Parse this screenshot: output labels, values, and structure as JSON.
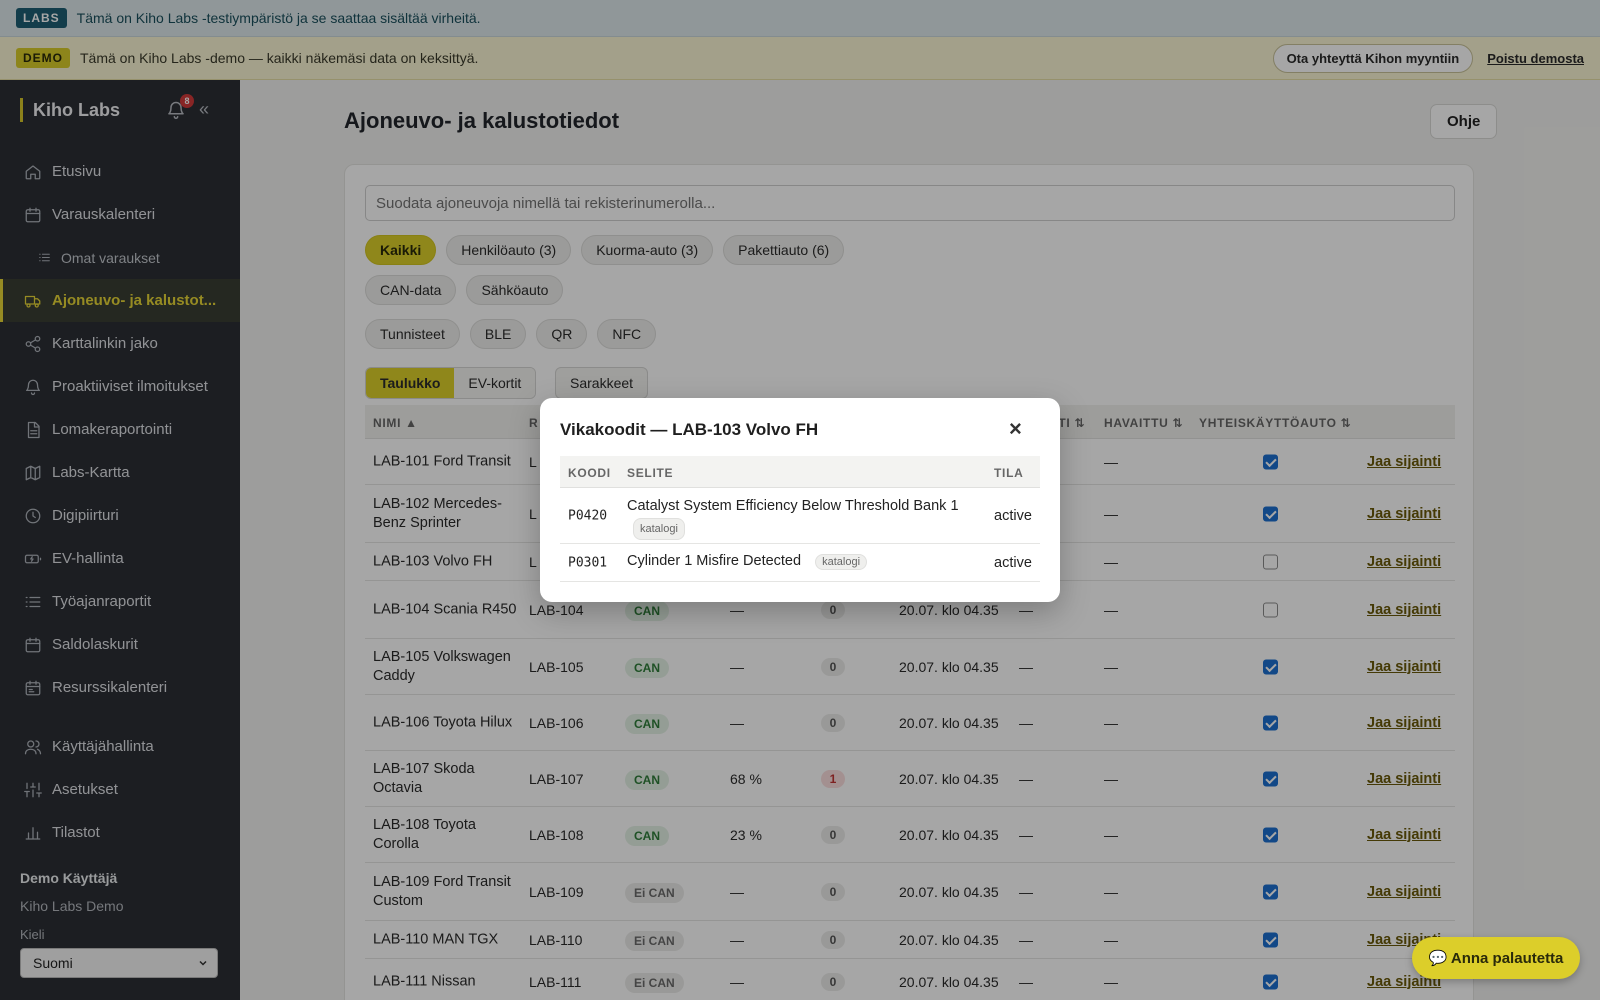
{
  "banners": {
    "labs_tag": "LABS",
    "labs_text": "Tämä on Kiho Labs -testiympäristö ja se saattaa sisältää virheitä.",
    "demo_tag": "DEMO",
    "demo_text": "Tämä on Kiho Labs -demo — kaikki näkemäsi data on keksittyä.",
    "contact_label": "Ota yhteyttä Kihon myyntiin",
    "exit_label": "Poistu demosta"
  },
  "sidebar": {
    "brand": "Kiho Labs",
    "notification_count": "8",
    "collapse_icon": "«",
    "items": [
      {
        "label": "Etusivu",
        "icon": "home-icon"
      },
      {
        "label": "Varauskalenteri",
        "icon": "calendar-icon"
      },
      {
        "label": "Omat varaukset",
        "icon": "list-icon"
      },
      {
        "label": "Ajoneuvo- ja kalustot...",
        "icon": "truck-icon"
      },
      {
        "label": "Karttalinkin jako",
        "icon": "share-icon"
      },
      {
        "label": "Proaktiiviset ilmoitukset",
        "icon": "bell-icon"
      },
      {
        "label": "Lomakeraportointi",
        "icon": "document-icon"
      },
      {
        "label": "Labs-Kartta",
        "icon": "map-icon"
      },
      {
        "label": "Digipiirturi",
        "icon": "clock-icon"
      },
      {
        "label": "EV-hallinta",
        "icon": "battery-icon"
      },
      {
        "label": "Työajanraportit",
        "icon": "list-icon"
      },
      {
        "label": "Saldolaskurit",
        "icon": "calendar-icon"
      },
      {
        "label": "Resurssikalenteri",
        "icon": "calendar-icon"
      },
      {
        "label": "Käyttäjähallinta",
        "icon": "users-icon"
      },
      {
        "label": "Asetukset",
        "icon": "sliders-icon"
      },
      {
        "label": "Tilastot",
        "icon": "bar-chart-icon"
      }
    ],
    "user_name": "Demo Käyttäjä",
    "org_name": "Kiho Labs Demo",
    "language_label": "Kieli",
    "language_value": "Suomi"
  },
  "main": {
    "title": "Ajoneuvo- ja kalustotiedot",
    "help_label": "Ohje",
    "filter_placeholder": "Suodata ajoneuvoja nimellä tai rekisterinumerolla...",
    "type_filters": [
      "Kaikki",
      "Henkilöauto (3)",
      "Kuorma-auto (3)",
      "Pakettiauto (6)"
    ],
    "feature_filters": [
      "CAN-data",
      "Sähköauto"
    ],
    "tag_filters": [
      "Tunnisteet",
      "BLE",
      "QR",
      "NFC"
    ],
    "views": [
      "Taulukko",
      "EV-kortit"
    ],
    "columns_label": "Sarakkeet",
    "table": {
      "headers": {
        "name": "NIMI ▲",
        "plate": "R",
        "location": "INTI ⇅",
        "seen": "HAVAITTU ⇅",
        "shared": "YHTEISKÄYTTÖAUTO ⇅"
      },
      "share_label": "Jaa sijainti",
      "rows": [
        {
          "name": "LAB-101 Ford Transit",
          "plate": "L",
          "can": "",
          "battery": "",
          "codes": "",
          "updated": "",
          "location": "—",
          "seen": "—",
          "shared": true
        },
        {
          "name": "LAB-102 Mercedes-Benz Sprinter",
          "plate": "L",
          "can": "",
          "battery": "",
          "codes": "",
          "updated": "",
          "location": "—",
          "seen": "—",
          "shared": true
        },
        {
          "name": "LAB-103 Volvo FH",
          "plate": "L",
          "can": "",
          "battery": "",
          "codes": "",
          "updated": "",
          "location": "—",
          "seen": "—",
          "shared": false
        },
        {
          "name": "LAB-104 Scania R450",
          "plate": "LAB-104",
          "can": "CAN",
          "battery": "—",
          "codes": "0",
          "updated": "20.07. klo 04.35",
          "location": "—",
          "seen": "—",
          "shared": false
        },
        {
          "name": "LAB-105 Volkswagen Caddy",
          "plate": "LAB-105",
          "can": "CAN",
          "battery": "—",
          "codes": "0",
          "updated": "20.07. klo 04.35",
          "location": "—",
          "seen": "—",
          "shared": true
        },
        {
          "name": "LAB-106 Toyota Hilux",
          "plate": "LAB-106",
          "can": "CAN",
          "battery": "—",
          "codes": "0",
          "updated": "20.07. klo 04.35",
          "location": "—",
          "seen": "—",
          "shared": true
        },
        {
          "name": "LAB-107 Skoda Octavia",
          "plate": "LAB-107",
          "can": "CAN",
          "battery": "68 %",
          "codes": "1",
          "updated": "20.07. klo 04.35",
          "location": "—",
          "seen": "—",
          "shared": true
        },
        {
          "name": "LAB-108 Toyota Corolla",
          "plate": "LAB-108",
          "can": "CAN",
          "battery": "23 %",
          "codes": "0",
          "updated": "20.07. klo 04.35",
          "location": "—",
          "seen": "—",
          "shared": true
        },
        {
          "name": "LAB-109 Ford Transit Custom",
          "plate": "LAB-109",
          "can": "Ei CAN",
          "battery": "—",
          "codes": "0",
          "updated": "20.07. klo 04.35",
          "location": "—",
          "seen": "—",
          "shared": true
        },
        {
          "name": "LAB-110 MAN TGX",
          "plate": "LAB-110",
          "can": "Ei CAN",
          "battery": "—",
          "codes": "0",
          "updated": "20.07. klo 04.35",
          "location": "—",
          "seen": "—",
          "shared": true
        },
        {
          "name": "LAB-111 Nissan",
          "plate": "LAB-111",
          "can": "Ei CAN",
          "battery": "—",
          "codes": "0",
          "updated": "20.07. klo 04.35",
          "location": "—",
          "seen": "—",
          "shared": true
        }
      ]
    }
  },
  "modal": {
    "title": "Vikakoodit — LAB-103 Volvo FH",
    "close": "×",
    "headers": {
      "code": "KOODI",
      "desc": "SELITE",
      "status": "TILA"
    },
    "rows": [
      {
        "code": "P0420",
        "desc": "Catalyst System Efficiency Below Threshold Bank 1",
        "tag": "katalogi",
        "status": "active"
      },
      {
        "code": "P0301",
        "desc": "Cylinder 1 Misfire Detected",
        "tag": "katalogi",
        "status": "active"
      }
    ]
  },
  "feedback": {
    "label": "💬 Anna palautetta"
  }
}
